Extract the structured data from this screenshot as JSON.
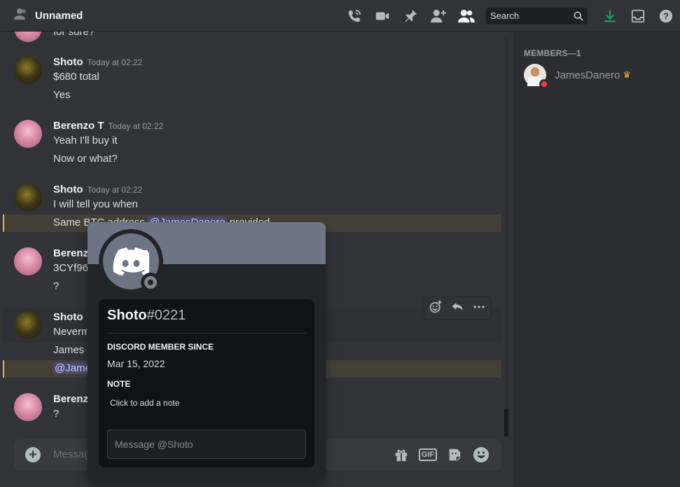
{
  "channel": {
    "title": "Unnamed",
    "icon": "members-icon"
  },
  "toolbar": {
    "icons": [
      "call-icon",
      "video-icon",
      "pin-icon",
      "add-friend-icon",
      "members-list-icon"
    ],
    "search_placeholder": "Search",
    "right_icons": [
      "download-icon",
      "inbox-icon",
      "help-icon"
    ]
  },
  "messages": {
    "partial_line": "for sure?",
    "m1": {
      "author": "Shoto",
      "time": "Today at 02:22",
      "lines": [
        "$680 total",
        "Yes"
      ]
    },
    "m2": {
      "author": "Berenzo T",
      "time": "Today at 02:22",
      "lines": [
        "Yeah I'll buy it",
        "Now or what?"
      ]
    },
    "m3": {
      "author": "Shoto",
      "time": "Today at 02:22",
      "line1": "I will tell you when",
      "line2_pre": "Same BTC address ",
      "line2_mention": "@JamesDanero",
      "line2_post": " provided"
    },
    "m4": {
      "author": "Berenzo",
      "line1": "3CYf96",
      "line2": "?"
    },
    "m5": {
      "author": "Shoto",
      "line1": "Neverm",
      "line2": "James c",
      "line3_mention": "@Jame"
    },
    "m6": {
      "author": "Berenzo",
      "line1": "?"
    }
  },
  "composer": {
    "placeholder": "Message",
    "gif_label": "GIF",
    "icons": [
      "add-icon",
      "gift-icon",
      "gif-icon",
      "sticker-icon",
      "emoji-icon"
    ]
  },
  "members": {
    "header": "MEMBERS—1",
    "list": [
      {
        "name": "JamesDanero",
        "status": "dnd",
        "owner": true
      }
    ]
  },
  "profile": {
    "username": "Shoto",
    "discriminator": "#0221",
    "member_since_label": "DISCORD MEMBER SINCE",
    "member_since": "Mar 15, 2022",
    "note_label": "NOTE",
    "note_placeholder": "Click to add a note",
    "message_placeholder": "Message @Shoto"
  },
  "colors": {
    "background": "#313338",
    "sidebar": "#2b2d31",
    "popout": "#232428",
    "banner": "#6d7483",
    "mention_highlight": "#f0b132",
    "dnd": "#f23f43",
    "download": "#23a55a"
  }
}
